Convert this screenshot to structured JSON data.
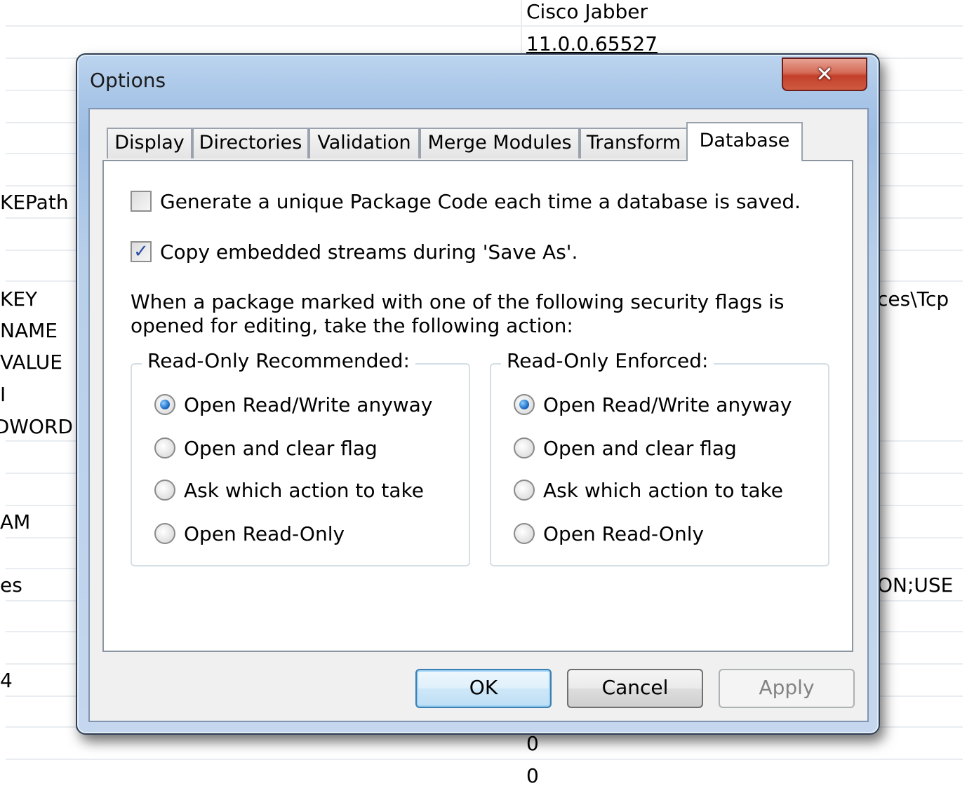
{
  "background_table": {
    "left_cells": [
      {
        "text": "KEPath",
        "row": 5
      },
      {
        "text": "KEY",
        "row": 8
      },
      {
        "text": "NAME",
        "row": 9
      },
      {
        "text": "VALUE",
        "row": 10
      },
      {
        "text": "I",
        "row": 11
      },
      {
        "text": "DWORD",
        "row": 12
      },
      {
        "text": "AM",
        "row": 15
      },
      {
        "text": "es",
        "row": 17
      },
      {
        "text": "4",
        "row": 20
      }
    ],
    "mid_cells": [
      {
        "text": "Cisco Jabber"
      },
      {
        "text": "11.0.0.65527"
      },
      {
        "text": "0"
      },
      {
        "text": "0"
      }
    ],
    "right_cells": [
      {
        "text": "ces\\Tcp"
      },
      {
        "text": "ON;USE"
      }
    ]
  },
  "dialog": {
    "title": "Options",
    "close_label": "✕",
    "tabs": [
      {
        "label": "Display",
        "active": false
      },
      {
        "label": "Directories",
        "active": false
      },
      {
        "label": "Validation",
        "active": false
      },
      {
        "label": "Merge Modules",
        "active": false
      },
      {
        "label": "Transform",
        "active": false
      },
      {
        "label": "Database",
        "active": true
      }
    ],
    "checkboxes": [
      {
        "label": "Generate a unique Package Code each time a database is saved.",
        "checked": false
      },
      {
        "label": "Copy embedded streams during 'Save As'.",
        "checked": true
      }
    ],
    "description": "When a package marked with one of the following security flags is opened for editing, take the following action:",
    "groups": [
      {
        "legend": "Read-Only Recommended:",
        "options": [
          {
            "label": "Open Read/Write anyway",
            "selected": true
          },
          {
            "label": "Open and clear flag",
            "selected": false
          },
          {
            "label": "Ask which action to take",
            "selected": false
          },
          {
            "label": "Open Read-Only",
            "selected": false
          }
        ]
      },
      {
        "legend": "Read-Only Enforced:",
        "options": [
          {
            "label": "Open Read/Write anyway",
            "selected": true
          },
          {
            "label": "Open and clear flag",
            "selected": false
          },
          {
            "label": "Ask which action to take",
            "selected": false
          },
          {
            "label": "Open Read-Only",
            "selected": false
          }
        ]
      }
    ],
    "buttons": {
      "ok": "OK",
      "cancel": "Cancel",
      "apply": "Apply"
    }
  },
  "colors": {
    "title_bar": "#a9c6e8",
    "close_button": "#c3402c",
    "radio_selected": "#1f6fc8",
    "check_mark": "#2b4fa8"
  },
  "icons": {
    "close": "close-icon",
    "check": "check-icon",
    "radio": "radio-dot-icon"
  }
}
